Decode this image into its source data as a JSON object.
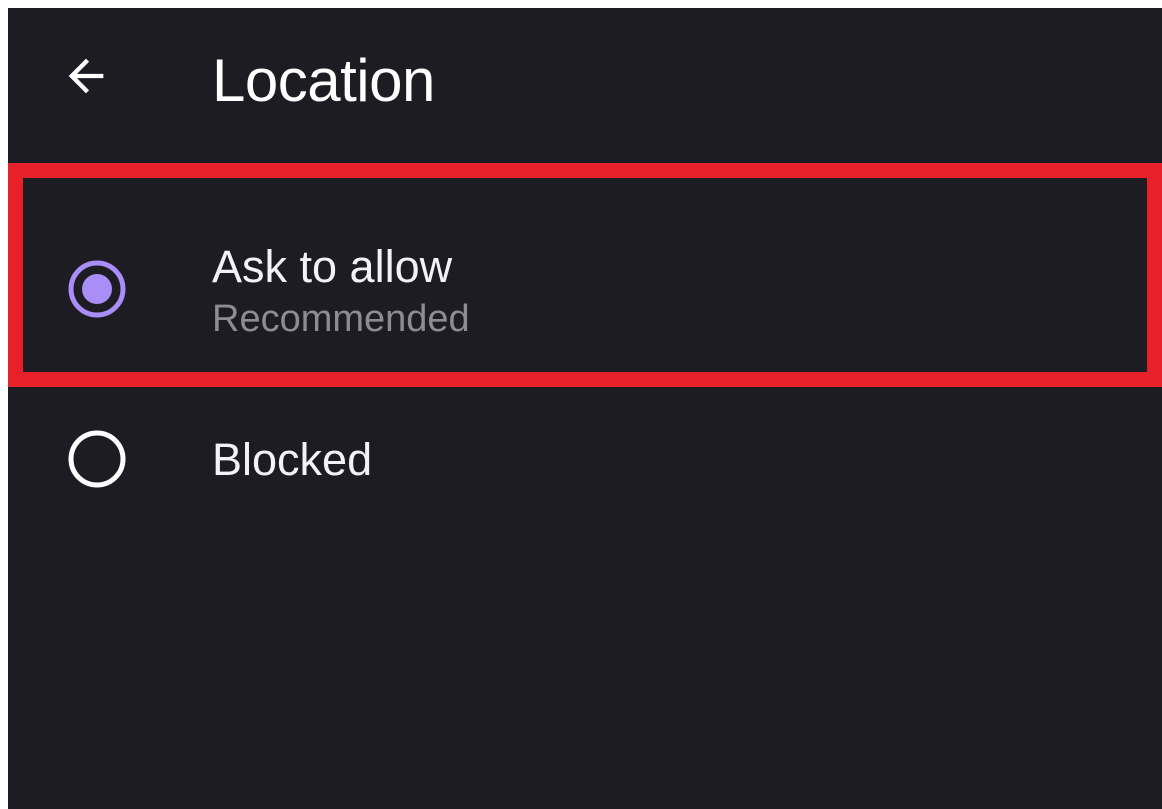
{
  "header": {
    "back_icon": "arrow-left-icon",
    "title": "Location"
  },
  "options": [
    {
      "label": "Ask to allow",
      "sublabel": "Recommended",
      "selected": true,
      "icon": "radio-checked-icon"
    },
    {
      "label": "Blocked",
      "selected": false,
      "icon": "radio-unchecked-icon"
    }
  ],
  "colors": {
    "background": "#1d1c22",
    "accent": "#a98ef7",
    "highlight_border": "#e8202a",
    "text_primary": "#f3f2f7",
    "text_secondary": "#8d8b95"
  }
}
